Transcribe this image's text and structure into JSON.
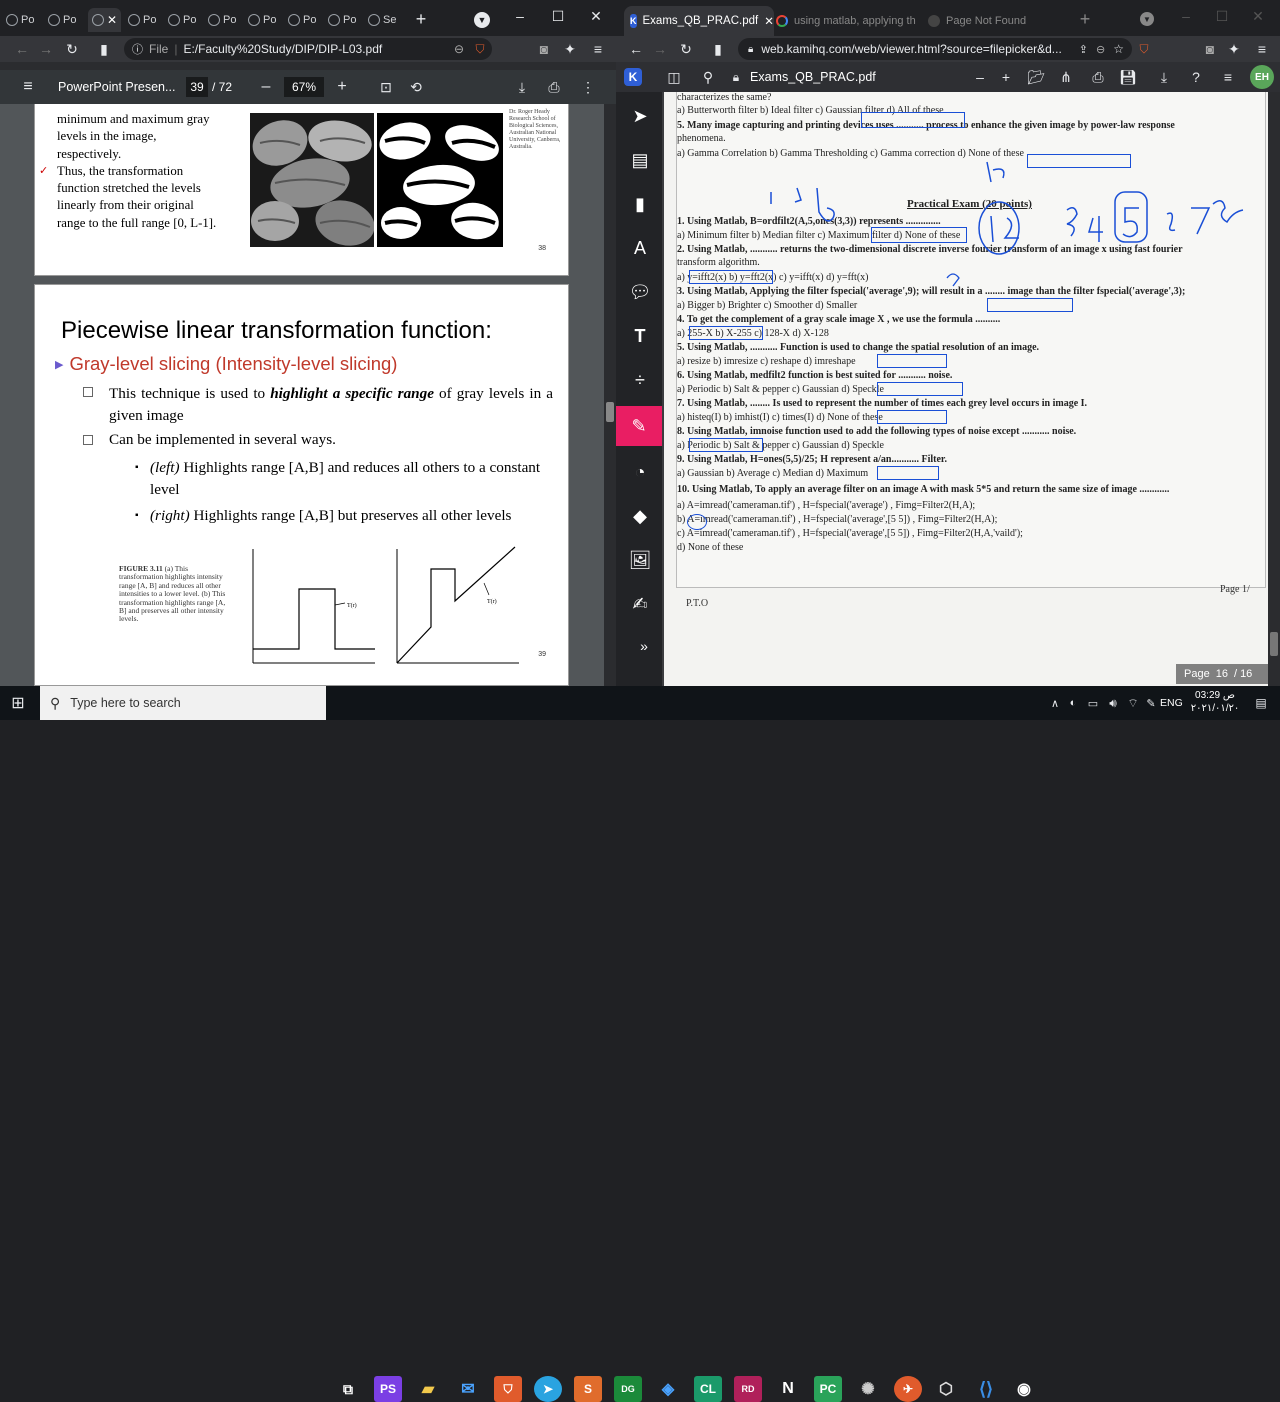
{
  "left_window": {
    "tabs": [
      "Po",
      "Po",
      "Po",
      "Po",
      "Po",
      "Po",
      "Po",
      "Po",
      "Se"
    ],
    "address": "E:/Faculty%20Study/DIP/DIP-L03.pdf",
    "file_label": "File",
    "pdf_title": "PowerPoint Presen...",
    "page_current": "39",
    "page_total": "/ 72",
    "zoom": "67%",
    "slide1": {
      "lines": [
        "minimum and maximum gray",
        "levels in the image,",
        "respectively.",
        "Thus, the transformation",
        "function stretched the levels",
        "linearly from their original",
        "range to the full range [0, L-1]."
      ],
      "page_no": "38",
      "side_caption": "Dr. Roger Heady Research School of Biological Sciences, Australian National University, Canberra, Australia."
    },
    "slide2": {
      "title": "Piecewise linear transformation function:",
      "subtitle": "Gray-level slicing (Intensity-level slicing)",
      "bullet1_pre": "This technique is used to ",
      "bullet1_em": "highlight a specific range",
      "bullet1_post": " of gray levels in a given image",
      "bullet2": "Can be implemented in several ways.",
      "sub1_em": "(left)",
      "sub1": " Highlights range [A,B] and reduces all others to a constant level",
      "sub2_em": "(right)",
      "sub2": " Highlights range [A,B] but preserves all other levels",
      "figure_caption_bold": "FIGURE 3.11",
      "figure_caption": " (a) This transformation highlights intensity range [A, B] and reduces all other intensities to a lower level. (b) This transformation highlights range [A, B] and preserves all other intensity levels.",
      "plot_label_left": "T(r)",
      "plot_label_right": "T(r)",
      "page_no": "39"
    }
  },
  "right_window": {
    "tabs": [
      {
        "label": "Exams_QB_PRAC.pdf",
        "active": true
      },
      {
        "label": "using matlab, applying th",
        "active": false
      },
      {
        "label": "Page Not Found",
        "active": false
      }
    ],
    "address": "web.kamihq.com/web/viewer.html?source=filepicker&d...",
    "kami_title": "Exams_QB_PRAC.pdf",
    "avatar": "EH",
    "exam": {
      "header_lines": [
        "characterizes the same?",
        "a)   Butterworth filter          b) Ideal filter           c) Gaussian filter          d) All of these",
        "5.  Many image capturing and printing devices uses ........... process to enhance the given image by power-law response",
        "     phenomena.",
        "     a)  Gamma Correlation          b) Gamma Thresholding           c) Gamma correction          d) None of these"
      ],
      "section_title": "Practical Exam (20 points)",
      "questions": [
        "1.  Using Matlab, B=ordfilt2(A,5,ones(3,3)) represents ..............",
        "     a)  Minimum filter              b) Median filter              c) Maximum filter              d) None of these",
        "2.  Using Matlab, ........... returns the two-dimensional discrete inverse fourier transform of an image x using fast fourier",
        "     transform algorithm.",
        "     a)  y=ifft2(x)                  b) y=fft2(x)                  c) y=ifft(x)                   d) y=fft(x)",
        "3.  Using Matlab, Applying the filter fspecial('average',9); will result in a ........ image than the filter fspecial('average',3);",
        "     a)  Bigger                      b) Brighter                   c) Smoother                    d) Smaller",
        "4.  To get the complement of a gray scale image X , we use the formula ..........",
        "     a)  255-X                       b) X-255                      c) 128-X                       d) X-128",
        "5.  Using Matlab, ........... Function is used to change the spatial resolution of an image.",
        "     a)  resize                      b) imresize                   c) reshape                     d) imreshape",
        "6.  Using Matlab, medfilt2  function is best suited for ........... noise.",
        "     a)  Periodic                    b) Salt & pepper              c) Gaussian                    d) Speckle",
        "7.  Using Matlab, ........ Is used to represent the number of times each grey level occurs in image I.",
        "     a)  histeq(I)                   b) imhist(I)                  c) times(I)                    d) None of these",
        "8.  Using Matlab, imnoise function  used to add the following types of noise except ........... noise.",
        "     a)  Periodic                    b) Salt & pepper              c) Gaussian                    d) Speckle",
        "9.  Using Matlab, H=ones(5,5)/25;  H represent a/an........... Filter.",
        "     a)  Gaussian                    b) Average                    c) Median                      d) Maximum",
        "10. Using Matlab, To apply an average filter on an image A with mask 5*5 and return the same size of image ............",
        "     a)  A=imread('cameraman.tif') , H=fspecial('average') , Fimg=Filter2(H,A);",
        "     b)  A=imread('cameraman.tif') , H=fspecial('average',[5 5]) , Fimg=Filter2(H,A);",
        "     c)  A=imread('cameraman.tif') , H=fspecial('average',[5 5]) , Fimg=Filter2(H,A,'vaild');",
        "     d)  None of these"
      ],
      "footer_left": "P.T.O",
      "footer_right": "Page 1/"
    },
    "page_indicator": {
      "label": "Page",
      "current": "16",
      "total": "/ 16"
    }
  },
  "taskbar": {
    "search_placeholder": "Type here to search",
    "lang": "ENG",
    "time": "03:29",
    "ampm": "ص",
    "date": "٢٠٢١/٠١/٢٠"
  }
}
